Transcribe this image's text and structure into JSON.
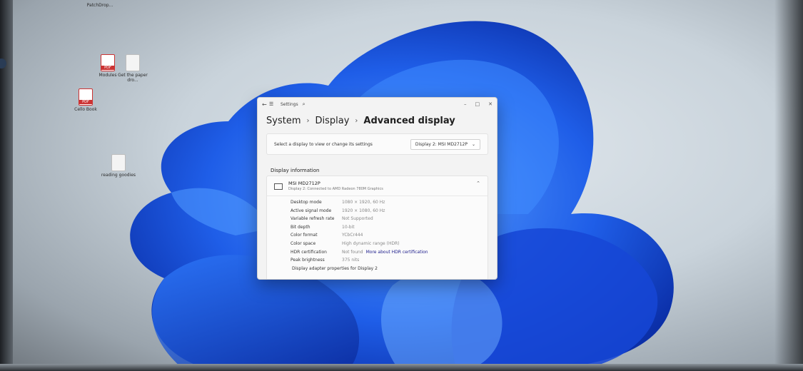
{
  "desktop": {
    "icons": [
      {
        "label": "PatchDrop..."
      },
      {
        "label": "Modules"
      },
      {
        "label": "Get the paper dro..."
      },
      {
        "label": "Cello Book"
      },
      {
        "label": "reading goodies"
      }
    ]
  },
  "window": {
    "title": "Settings",
    "breadcrumb": [
      "System",
      "Display",
      "Advanced display"
    ],
    "select_prompt": "Select a display to view or change its settings",
    "selected_display": "Display 2: MSI MD2712P",
    "section_title": "Display information",
    "monitor": {
      "name": "MSI MD2712P",
      "subtitle": "Display 2: Connected to AMD Radeon 780M Graphics"
    },
    "properties": [
      {
        "key": "Desktop mode",
        "value": "1080 × 1920, 60 Hz"
      },
      {
        "key": "Active signal mode",
        "value": "1920 × 1080, 60 Hz"
      },
      {
        "key": "Variable refresh rate",
        "value": "Not Supported"
      },
      {
        "key": "Bit depth",
        "value": "10-bit"
      },
      {
        "key": "Color format",
        "value": "YCbCr444"
      },
      {
        "key": "Color space",
        "value": "High dynamic range (HDR)"
      },
      {
        "key": "HDR certification",
        "value": "Not found",
        "link": "More about HDR certification"
      },
      {
        "key": "Peak brightness",
        "value": "375 nits"
      }
    ],
    "adapter_link": "Display adapter properties for Display 2"
  },
  "colors": {
    "bloom_dark": "#0a2fb8",
    "bloom_light": "#3d86ff"
  }
}
